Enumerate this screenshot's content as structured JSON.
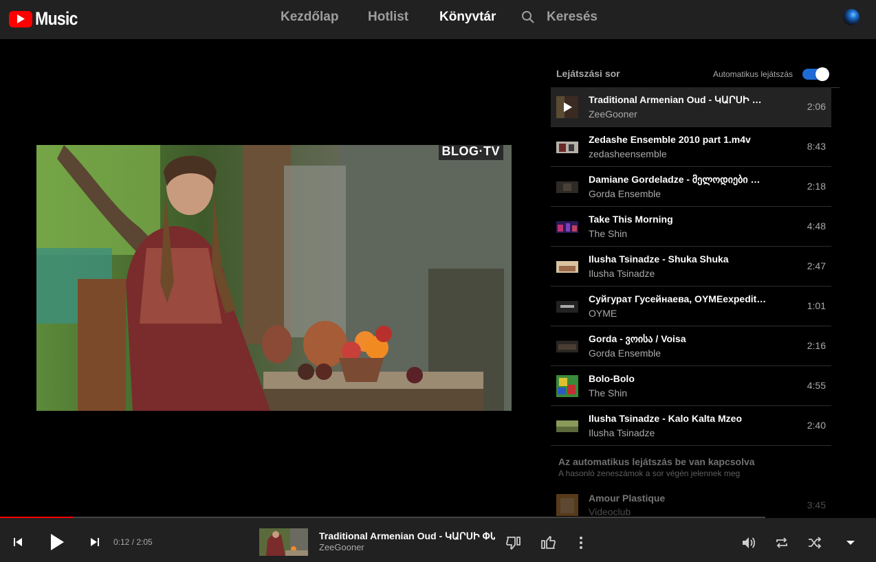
{
  "app": {
    "logo_text": "Music",
    "brand_color": "#ff0000",
    "accent_color": "#1e6bd6"
  },
  "nav": {
    "home": "Kezdőlap",
    "hotlist": "Hotlist",
    "library": "Könyvtár",
    "search": "Keresés",
    "active": "library"
  },
  "video": {
    "watermark": "BLOG·TV"
  },
  "queue": {
    "title": "Lejátszási sor",
    "autoplay_label": "Automatikus lejátszás",
    "autoplay_on": true,
    "items": [
      {
        "title": "Traditional Armenian Oud - ԿԱՐՍԻ Փ...",
        "artist": "ZeeGooner",
        "duration": "2:06",
        "playing": true,
        "thumb_icon": "play-icon"
      },
      {
        "title": "Zedashe Ensemble 2010 part 1.m4v",
        "artist": "zedasheensemble",
        "duration": "8:43",
        "playing": false
      },
      {
        "title": "Damiane Gordeladze - მელოდიები ფა...",
        "artist": "Gorda Ensemble",
        "duration": "2:18",
        "playing": false
      },
      {
        "title": "Take This Morning",
        "artist": "The Shin",
        "duration": "4:48",
        "playing": false
      },
      {
        "title": "Ilusha Tsinadze - Shuka Shuka",
        "artist": "Ilusha Tsinadze",
        "duration": "2:47",
        "playing": false
      },
      {
        "title": "Суйгурат Гусейнаева, OYMEexpeditio...",
        "artist": "OYME",
        "duration": "1:01",
        "playing": false
      },
      {
        "title": "Gorda - ვოისა / Voisa",
        "artist": "Gorda Ensemble",
        "duration": "2:16",
        "playing": false
      },
      {
        "title": "Bolo-Bolo",
        "artist": "The Shin",
        "duration": "4:55",
        "playing": false
      },
      {
        "title": "Ilusha Tsinadze - Kalo Kalta Mzeo",
        "artist": "Ilusha Tsinadze",
        "duration": "2:40",
        "playing": false
      }
    ],
    "autoplay_note_title": "Az automatikus lejátszás be van kapcsolva",
    "autoplay_note_sub": "A hasonló zeneszámok a sor végén jelennek meg",
    "autoplay_item": {
      "title": "Amour Plastique",
      "artist": "Videoclub",
      "duration": "3:45"
    }
  },
  "player": {
    "time": "0:12 / 2:05",
    "progress_fraction": 0.096,
    "title": "Traditional Armenian Oud - ԿԱՐՍԻ ՓԱՐ",
    "artist": "ZeeGooner"
  }
}
